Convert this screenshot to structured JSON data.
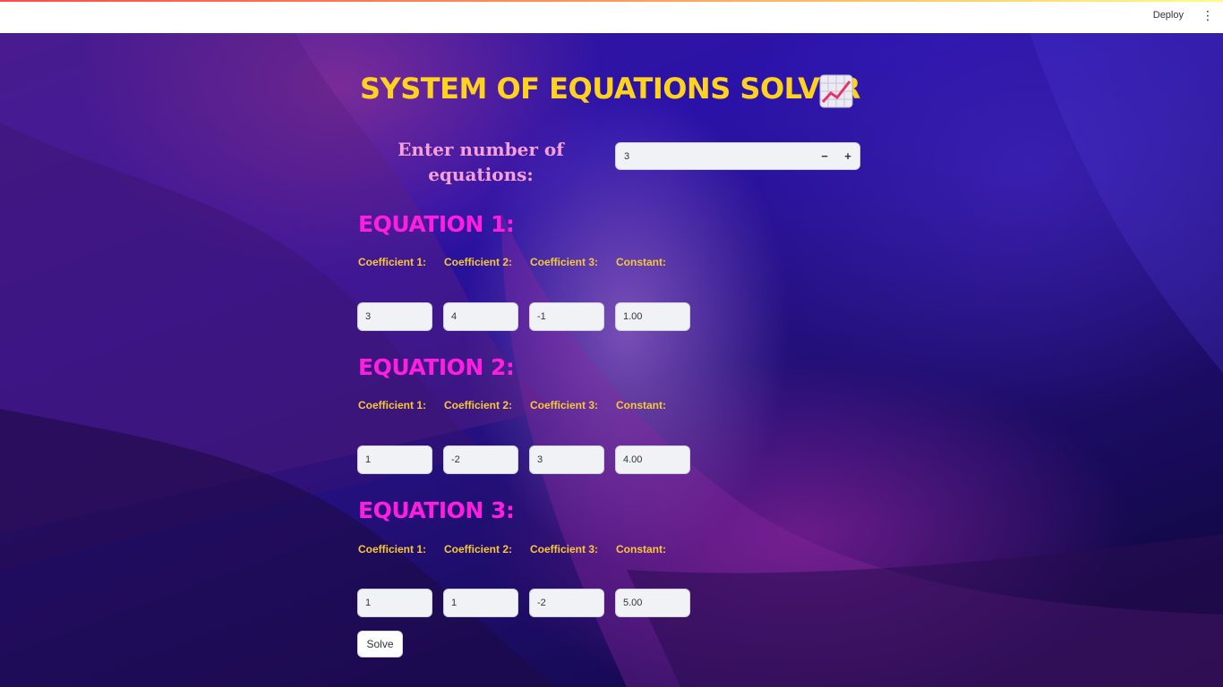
{
  "header": {
    "deploy_label": "Deploy",
    "menu_icon": "more-vertical-icon"
  },
  "title": "SYSTEM OF EQUATIONS SOLVER",
  "title_icon": "chart-increasing-icon",
  "num_equations": {
    "label": "Enter number of equations:",
    "value": "3"
  },
  "equations": [
    {
      "heading": "EQUATION 1:",
      "labels": [
        "Coefficient 1:",
        "Coefficient 2:",
        "Coefficient 3:",
        "Constant:"
      ],
      "values": [
        "3",
        "4",
        "-1",
        "1.00"
      ]
    },
    {
      "heading": "EQUATION 2:",
      "labels": [
        "Coefficient 1:",
        "Coefficient 2:",
        "Coefficient 3:",
        "Constant:"
      ],
      "values": [
        "1",
        "-2",
        "3",
        "4.00"
      ]
    },
    {
      "heading": "EQUATION 3:",
      "labels": [
        "Coefficient 1:",
        "Coefficient 2:",
        "Coefficient 3:",
        "Constant:"
      ],
      "values": [
        "1",
        "1",
        "-2",
        "5.00"
      ]
    }
  ],
  "solve_label": "Solve",
  "colors": {
    "title": "#ffd21f",
    "equation_heading": "#ff1ee0",
    "coefficient_label": "#f7c838",
    "number_label": "#f5a0d8"
  }
}
